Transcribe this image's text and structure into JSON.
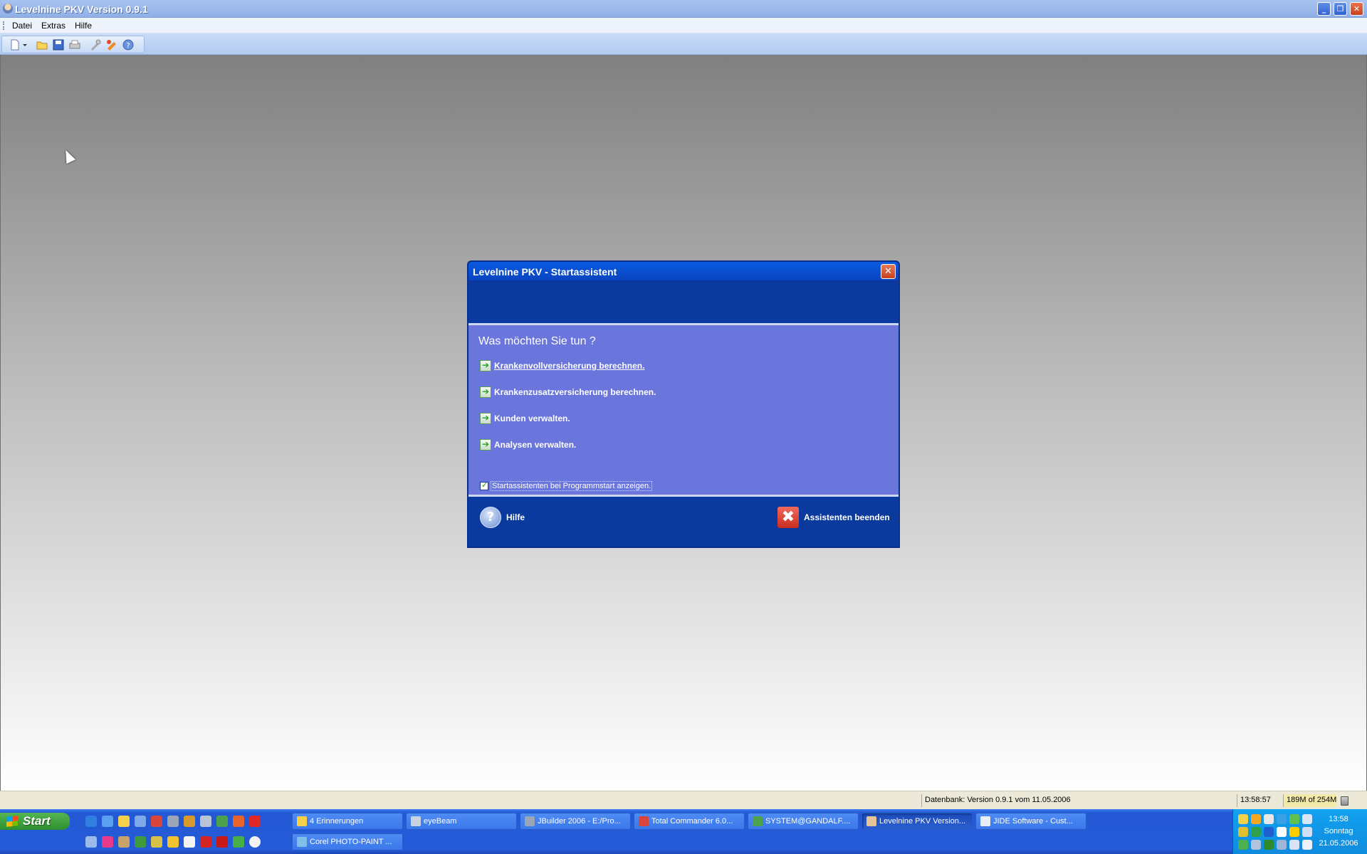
{
  "window": {
    "title": "Levelnine PKV Version 0.9.1"
  },
  "menu": {
    "items": [
      "Datei",
      "Extras",
      "Hilfe"
    ]
  },
  "toolbar": {
    "buttons": [
      "new-document-icon",
      "dropdown-arrow-icon",
      "open-folder-icon",
      "save-icon",
      "print-icon",
      "tools-icon",
      "settings-icon",
      "help-icon"
    ]
  },
  "dialog": {
    "title": "Levelnine PKV - Startassistent",
    "question": "Was möchten Sie tun ?",
    "options": [
      "Krankenvollversicherung berechnen.",
      "Krankenzusatzversicherung berechnen.",
      "Kunden verwalten.",
      "Analysen verwalten."
    ],
    "startup_checkbox": {
      "label": "Startassistenten bei Programmstart anzeigen.",
      "checked": true
    },
    "help_label": "Hilfe",
    "quit_label": "Assistenten beenden"
  },
  "statusbar": {
    "database": "Datenbank: Version 0.9.1 vom 11.05.2006",
    "time": "13:58:57",
    "memory": "189M of 254M"
  },
  "taskbar": {
    "start_label": "Start",
    "tasks": [
      "4 Erinnerungen",
      "eyeBeam",
      "JBuilder 2006 - E:/Pro...",
      "Total Commander 6.0...",
      "SYSTEM@GANDALF....",
      "Levelnine PKV Version...",
      "JIDE Software - Cust...",
      "Corel PHOTO-PAINT ..."
    ],
    "active_task": "Levelnine PKV Version...",
    "clock": {
      "time": "13:58",
      "day": "Sonntag",
      "date": "21.05.2006"
    }
  },
  "colors": {
    "dialog_header": "#0a3a9e",
    "dialog_body": "#6a76dc",
    "taskbar": "#245bd8",
    "tray": "#0f8bde"
  }
}
